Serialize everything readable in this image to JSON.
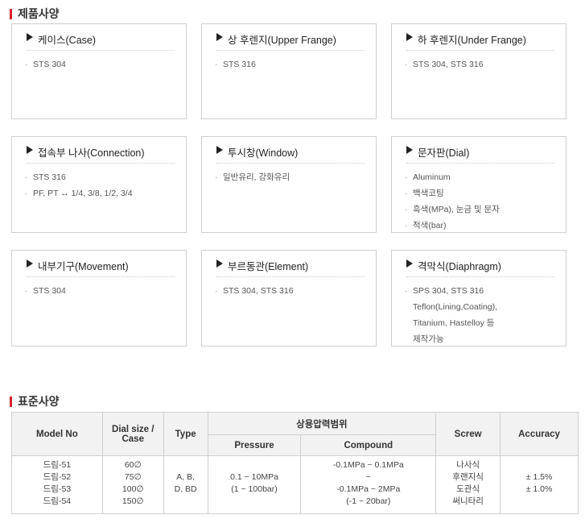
{
  "section_product": "제품사양",
  "cards": [
    {
      "title": "케이스(Case)",
      "items": [
        "STS 304"
      ]
    },
    {
      "title": "상 후렌지(Upper Frange)",
      "items": [
        "STS 316"
      ]
    },
    {
      "title": "하 후렌지(Under Frange)",
      "items": [
        "STS 304, STS 316"
      ]
    },
    {
      "title": "접속부 나사(Connection)",
      "items": [
        "STS 316",
        "PF, PT ↔ 1/4, 3/8, 1/2, 3/4"
      ]
    },
    {
      "title": "투시창(Window)",
      "items": [
        "일반유리, 강화유리"
      ]
    },
    {
      "title": "문자판(Dial)",
      "items": [
        "Aluminum",
        "백색코팅",
        "흑색(MPa), 눈금 및 문자",
        "적색(bar)"
      ]
    },
    {
      "title": "내부기구(Movement)",
      "items": [
        "STS 304"
      ]
    },
    {
      "title": "부르동관(Element)",
      "items": [
        "STS 304, STS 316"
      ]
    },
    {
      "title": "격막식(Diaphragm)",
      "items": [
        "SPS 304, STS 316",
        "Teflon(Lining,Coating),",
        "Titanium, Hastelloy 등",
        "제작가능"
      ]
    }
  ],
  "section_standard": "표준사양",
  "table": {
    "headers": {
      "model": "Model No",
      "dial": "Dial size / Case",
      "type": "Type",
      "range": "상용압력범위",
      "pressure": "Pressure",
      "compound": "Compound",
      "screw": "Screw",
      "accuracy": "Accuracy"
    },
    "models": [
      "드림-51",
      "드림-52",
      "드림-53",
      "드림-54"
    ],
    "dials": [
      "60∅",
      "75∅",
      "100∅",
      "150∅"
    ],
    "types": [
      "",
      "A, B,",
      "D, BD",
      ""
    ],
    "pressure": [
      "",
      "0.1 ~ 10MPa",
      "(1 ~ 100bar)",
      ""
    ],
    "compound": [
      "-0.1MPa ~ 0.1MPa",
      "~",
      "-0.1MPa ~ 2MPa",
      "(-1 ~ 20bar)"
    ],
    "screws": [
      "나사식",
      "후랜지식",
      "도관식",
      "써니타리"
    ],
    "accuracy": [
      "",
      "± 1.5%",
      "± 1.0%",
      ""
    ]
  }
}
